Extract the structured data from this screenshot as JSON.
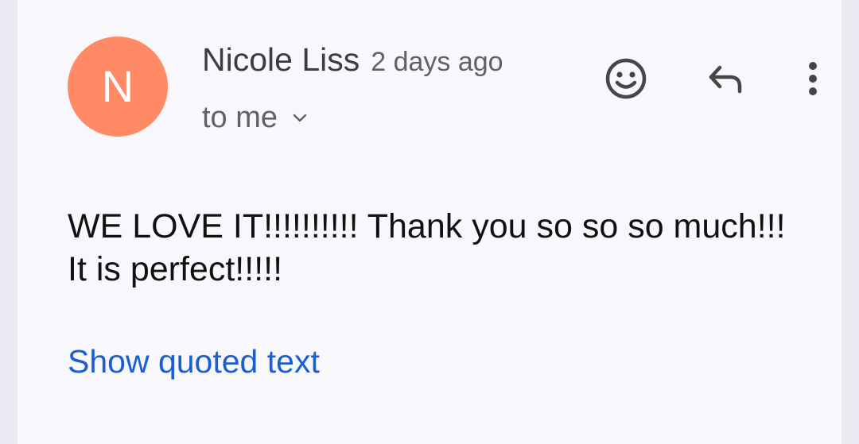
{
  "email": {
    "sender": {
      "initial": "N",
      "name": "Nicole Liss",
      "avatar_color": "#ff8a65"
    },
    "timestamp": "2 days ago",
    "recipient": "to me",
    "body_lines": [
      "WE LOVE IT!!!!!!!!!! Thank you so so so much!!!",
      "It is perfect!!!!!"
    ],
    "show_quoted_label": "Show quoted text"
  },
  "actions": {
    "icons": [
      "smiley-face-icon",
      "reply-arrow-icon",
      "more-vertical-icon"
    ]
  },
  "colors": {
    "link": "#1a5fd1",
    "background": "#f8f7fc"
  }
}
